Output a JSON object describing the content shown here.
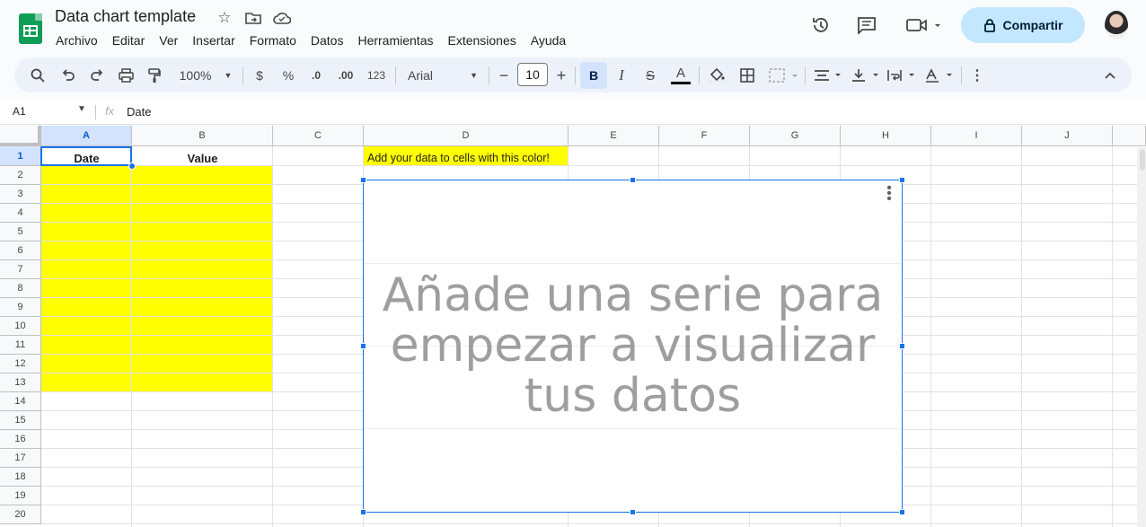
{
  "app": {
    "doc_title": "Data chart template",
    "menu": [
      "Archivo",
      "Editar",
      "Ver",
      "Insertar",
      "Formato",
      "Datos",
      "Herramientas",
      "Extensiones",
      "Ayuda"
    ],
    "share_label": "Compartir",
    "accent_color": "#0b57d0",
    "share_bg": "#c2e7ff"
  },
  "toolbar": {
    "zoom": "100%",
    "currency": "$",
    "percent": "%",
    "dec_decrease": ".0",
    "dec_increase": ".00",
    "number_format": "123",
    "font": "Arial",
    "font_size": "10",
    "bold": "B",
    "italic": "I",
    "strike": "S",
    "text_color": "A"
  },
  "formula_bar": {
    "cell_ref": "A1",
    "fx": "fx",
    "value": "Date"
  },
  "grid": {
    "columns": [
      "A",
      "B",
      "C",
      "D",
      "E",
      "F",
      "G",
      "H",
      "I",
      "J"
    ],
    "rows": [
      "1",
      "2",
      "3",
      "4",
      "5",
      "6",
      "7",
      "8",
      "9",
      "10",
      "11",
      "12",
      "13",
      "14",
      "15",
      "16",
      "17",
      "18",
      "19",
      "20"
    ],
    "cells": {
      "A1": "Date",
      "B1": "Value",
      "D1": "Add your data to cells with this color!"
    },
    "highlight_color": "#ffff00"
  },
  "chart": {
    "empty_message": "Añade una serie para empezar a visualizar tus datos",
    "menu_icon": "more-vert-icon"
  }
}
